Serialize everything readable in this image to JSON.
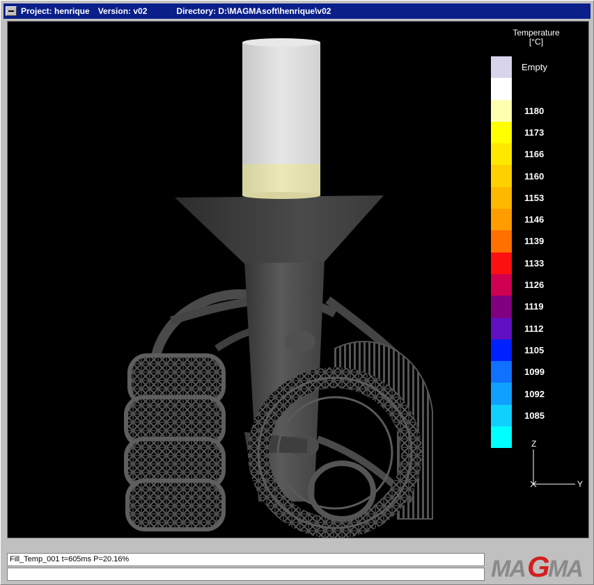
{
  "window": {
    "project": "Project: henrique",
    "version": "Version: v02",
    "directory": "Directory: D:\\MAGMAsoft\\henrique\\v02"
  },
  "legend": {
    "title_line1": "Temperature",
    "title_line2": "[°C]",
    "entries": [
      {
        "label": "Empty",
        "color": "#d8d4ec"
      },
      {
        "label": "",
        "color": "#ffffff"
      },
      {
        "label": "1180",
        "color": "#ffffb0"
      },
      {
        "label": "1173",
        "color": "#ffff00"
      },
      {
        "label": "1166",
        "color": "#ffe800"
      },
      {
        "label": "1160",
        "color": "#ffd000"
      },
      {
        "label": "1153",
        "color": "#ffb800"
      },
      {
        "label": "1146",
        "color": "#ff9c00"
      },
      {
        "label": "1139",
        "color": "#ff7000"
      },
      {
        "label": "1133",
        "color": "#ff1010"
      },
      {
        "label": "1126",
        "color": "#d00050"
      },
      {
        "label": "1119",
        "color": "#800080"
      },
      {
        "label": "1112",
        "color": "#6010c0"
      },
      {
        "label": "1105",
        "color": "#0020ff"
      },
      {
        "label": "1099",
        "color": "#1070ff"
      },
      {
        "label": "1092",
        "color": "#10a0ff"
      },
      {
        "label": "1085",
        "color": "#10d0ff"
      },
      {
        "label": "",
        "color": "#00ffff"
      }
    ]
  },
  "axes": {
    "z": "Z",
    "y": "Y"
  },
  "status": {
    "line1": "Fill_Temp_001 t=605ms P=20.16%",
    "line2": ""
  },
  "logo": {
    "text": "MAGMA",
    "color": "#d42020"
  }
}
